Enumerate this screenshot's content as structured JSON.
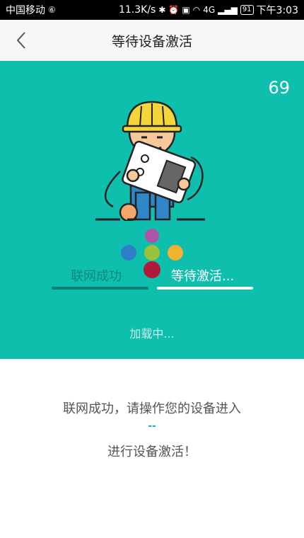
{
  "status_bar": {
    "carrier": "中国移动",
    "speed": "11.3K/s",
    "signal_label": "4G",
    "battery": "91",
    "time": "下午3:03"
  },
  "nav": {
    "back_icon": "chevron-left-icon",
    "title": "等待设备激活"
  },
  "panel": {
    "bg_color": "#0fbfae",
    "countdown": "69",
    "steps": [
      {
        "label": "联网成功",
        "state": "done"
      },
      {
        "label": "等待激活...",
        "state": "active"
      }
    ],
    "loading_text": "加载中..."
  },
  "message": {
    "line1": "联网成功，请操作您的设备进入",
    "separator": "--",
    "line2": "进行设备激活！"
  }
}
